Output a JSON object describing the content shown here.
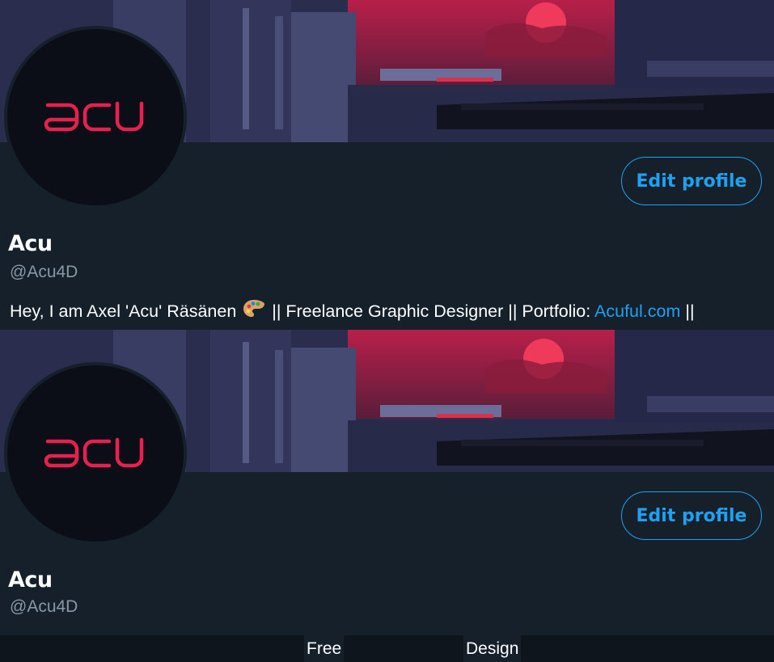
{
  "profile_1": {
    "avatar_text": "acu",
    "edit_button_label": "Edit profile",
    "display_name": "Acu",
    "handle": "@Acu4D",
    "bio": {
      "prefix": "Hey, I am Axel 'Acu' Räsänen",
      "emoji_icon": "artist-palette-icon",
      "middle": "|| Freelance Graphic Designer || Portfolio:",
      "link_text": "Acuful.com",
      "suffix": "||"
    }
  },
  "profile_2": {
    "avatar_text": "acu",
    "edit_button_label": "Edit profile",
    "display_name": "Acu",
    "handle": "@Acu4D"
  },
  "bottom_strip": {
    "word_1": "Free",
    "word_2": "Design"
  },
  "colors": {
    "background": "#15202b",
    "accent": "#1da1f2",
    "secondary_text": "#8899a6",
    "logo": "#e8204e"
  }
}
